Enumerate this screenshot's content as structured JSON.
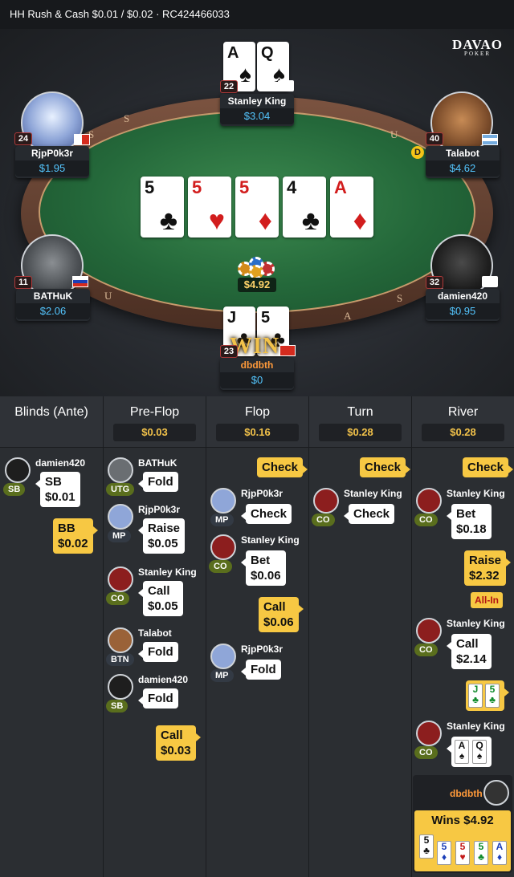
{
  "header": {
    "text": "HH  Rush & Cash $0.01 / $0.02  · RC424466033"
  },
  "logo": {
    "top": "DAVAO",
    "bottom": "POKER"
  },
  "rail_letters": [
    "S",
    "S",
    "U",
    "U",
    "A",
    "S"
  ],
  "pot": "$4.92",
  "win_text": "WIN",
  "board": [
    {
      "rank": "5",
      "suit": "♣",
      "color": "black"
    },
    {
      "rank": "5",
      "suit": "♥",
      "color": "red"
    },
    {
      "rank": "5",
      "suit": "♦",
      "color": "red"
    },
    {
      "rank": "4",
      "suit": "♣",
      "color": "black"
    },
    {
      "rank": "A",
      "suit": "♦",
      "color": "red"
    }
  ],
  "seats": {
    "top": {
      "name": "Stanley King",
      "stack": "$3.04",
      "level": "22",
      "cards": [
        {
          "rank": "A",
          "suit": "♠"
        },
        {
          "rank": "Q",
          "suit": "♠"
        }
      ]
    },
    "left_top": {
      "name": "RjpP0k3r",
      "stack": "$1.95",
      "level": "24"
    },
    "right_top": {
      "name": "Talabot",
      "stack": "$4.62",
      "level": "40",
      "dealer": "D"
    },
    "left_bottom": {
      "name": "BATHuK",
      "stack": "$2.06",
      "level": "11"
    },
    "right_bottom": {
      "name": "damien420",
      "stack": "$0.95",
      "level": "32"
    },
    "bottom": {
      "name": "dbdbth",
      "stack": "$0",
      "level": "23",
      "cards": [
        {
          "rank": "J",
          "suit": "♣"
        },
        {
          "rank": "5",
          "suit": "♣"
        }
      ]
    }
  },
  "history": {
    "columns": [
      {
        "title": "Blinds (Ante)",
        "value": ""
      },
      {
        "title": "Pre-Flop",
        "value": "$0.03"
      },
      {
        "title": "Flop",
        "value": "$0.16"
      },
      {
        "title": "Turn",
        "value": "$0.28"
      },
      {
        "title": "River",
        "value": "$0.28"
      }
    ],
    "blinds": {
      "sb_name": "damien420",
      "sb_pos": "SB",
      "sb_action": "SB",
      "sb_amount": "$0.01",
      "bb_action": "BB",
      "bb_amount": "$0.02"
    },
    "preflop": [
      {
        "name": "BATHuK",
        "pos": "UTG",
        "action": "Fold",
        "amount": ""
      },
      {
        "name": "RjpP0k3r",
        "pos": "MP",
        "action": "Raise",
        "amount": "$0.05"
      },
      {
        "name": "Stanley King",
        "pos": "CO",
        "action": "Call",
        "amount": "$0.05"
      },
      {
        "name": "Talabot",
        "pos": "BTN",
        "action": "Fold",
        "amount": ""
      },
      {
        "name": "damien420",
        "pos": "SB",
        "action": "Fold",
        "amount": ""
      }
    ],
    "preflop_hero": {
      "action": "Call",
      "amount": "$0.03"
    },
    "flop_hero_1": "Check",
    "flop": [
      {
        "name": "RjpP0k3r",
        "pos": "MP",
        "action": "Check",
        "amount": ""
      },
      {
        "name": "Stanley King",
        "pos": "CO",
        "action": "Bet",
        "amount": "$0.06"
      },
      {
        "name": "RjpP0k3r",
        "pos": "MP",
        "action": "Fold",
        "amount": ""
      }
    ],
    "flop_hero_2": {
      "action": "Call",
      "amount": "$0.06"
    },
    "turn_hero": "Check",
    "turn": {
      "name": "Stanley King",
      "pos": "CO",
      "action": "Check"
    },
    "river_hero": "Check",
    "river": [
      {
        "name": "Stanley King",
        "pos": "CO",
        "action": "Bet",
        "amount": "$0.18"
      },
      {
        "name": "Stanley King",
        "pos": "CO",
        "action": "Call",
        "amount": "$2.14"
      },
      {
        "name": "Stanley King",
        "pos": "CO",
        "action": "",
        "amount": ""
      }
    ],
    "river_raise": {
      "action": "Raise",
      "amount": "$2.32",
      "tag": "All-In"
    },
    "hero_show": [
      {
        "rank": "J",
        "suit": "♣"
      },
      {
        "rank": "5",
        "suit": "♣"
      }
    ],
    "villain_show": [
      {
        "rank": "A",
        "suit": "♠"
      },
      {
        "rank": "Q",
        "suit": "♠"
      }
    ],
    "winner": {
      "name": "dbdbth",
      "text": "Wins $4.92",
      "cards": [
        {
          "rank": "5",
          "suit": "♣"
        },
        {
          "rank": "5",
          "suit": "♦"
        },
        {
          "rank": "5",
          "suit": "♥"
        },
        {
          "rank": "5",
          "suit": "♣"
        },
        {
          "rank": "A",
          "suit": "♦"
        }
      ]
    }
  }
}
